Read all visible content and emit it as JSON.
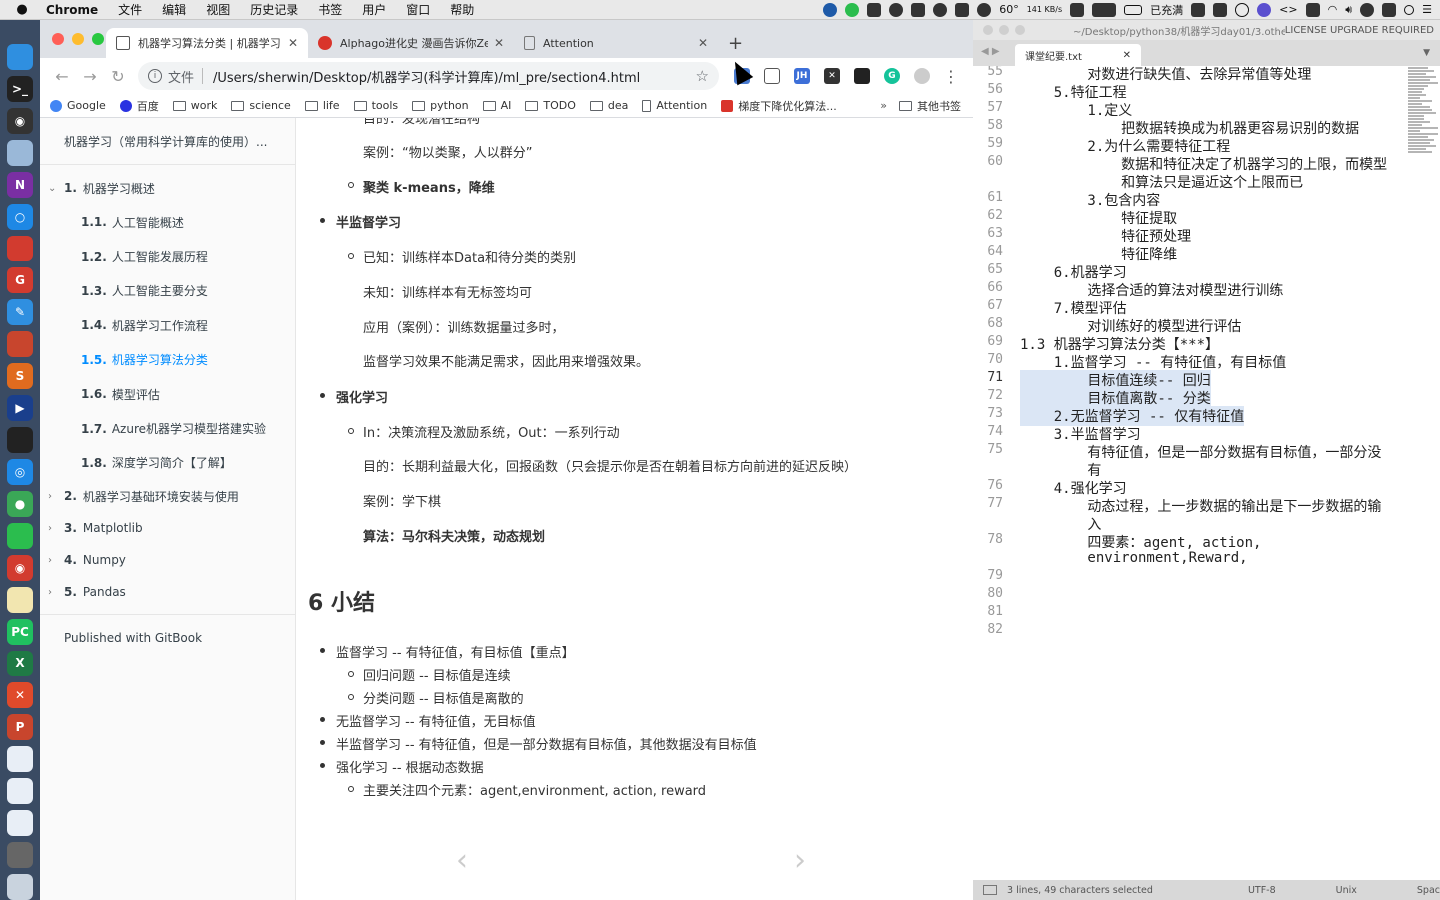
{
  "menubar": {
    "app": "Chrome",
    "items": [
      "文件",
      "编辑",
      "视图",
      "历史记录",
      "书签",
      "用户",
      "窗口",
      "帮助"
    ],
    "tray": {
      "temp": "60°",
      "net": "141 KB/s",
      "battery": "已充满"
    }
  },
  "dock": {
    "icons": [
      {
        "name": "finder-icon",
        "color": "#2f8fe0",
        "glyph": ""
      },
      {
        "name": "terminal-icon",
        "color": "#222222",
        "glyph": ">_"
      },
      {
        "name": "obs-icon",
        "color": "#333333",
        "glyph": "◉"
      },
      {
        "name": "preview-icon",
        "color": "#9ab8d8",
        "glyph": ""
      },
      {
        "name": "onenote-icon",
        "color": "#7a2fa3",
        "glyph": "N"
      },
      {
        "name": "tunnel-icon",
        "color": "#1e88e5",
        "glyph": "○"
      },
      {
        "name": "wps-icon",
        "color": "#d23b2f",
        "glyph": ""
      },
      {
        "name": "grammarly-icon",
        "color": "#d23b2f",
        "glyph": "G"
      },
      {
        "name": "pencil-icon",
        "color": "#2f8fe0",
        "glyph": "✎"
      },
      {
        "name": "powerpoint-icon",
        "color": "#c8452d",
        "glyph": ""
      },
      {
        "name": "sublime-icon",
        "color": "#e06b1f",
        "glyph": "S"
      },
      {
        "name": "quicktime-icon",
        "color": "#1a3f8c",
        "glyph": "▶"
      },
      {
        "name": "activity-monitor-icon",
        "color": "#222222",
        "glyph": ""
      },
      {
        "name": "safari-icon",
        "color": "#1e88e5",
        "glyph": "◎"
      },
      {
        "name": "chrome-icon",
        "color": "#3aa757",
        "glyph": "●"
      },
      {
        "name": "wechat-icon",
        "color": "#2bbd4e",
        "glyph": ""
      },
      {
        "name": "netease-music-icon",
        "color": "#d23b2f",
        "glyph": "◉"
      },
      {
        "name": "notes-icon",
        "color": "#f2e6b0",
        "glyph": ""
      },
      {
        "name": "pycharm-icon",
        "color": "#20c060",
        "glyph": "PC"
      },
      {
        "name": "excel-icon",
        "color": "#1f7a45",
        "glyph": "X"
      },
      {
        "name": "xmind-icon",
        "color": "#e04a2b",
        "glyph": "✕"
      },
      {
        "name": "powerpoint2-icon",
        "color": "#c8452d",
        "glyph": "P"
      },
      {
        "name": "document-icon",
        "color": "#e8eef6",
        "glyph": ""
      },
      {
        "name": "file-icon",
        "color": "#e8eef6",
        "glyph": ""
      },
      {
        "name": "file2-icon",
        "color": "#e8eef6",
        "glyph": ""
      },
      {
        "name": "screenshot-icon",
        "color": "#666666",
        "glyph": ""
      },
      {
        "name": "trash-icon",
        "color": "#c9d3de",
        "glyph": ""
      }
    ]
  },
  "browser": {
    "tabs": [
      {
        "title": "机器学习算法分类 | 机器学习 (",
        "icon_color": "#555555",
        "active": true
      },
      {
        "title": "Alphago进化史 漫画告诉你Zer",
        "icon_color": "#d9342b",
        "active": false
      },
      {
        "title": "Attention",
        "icon_color": "#777777",
        "active": false
      }
    ],
    "scheme_label": "文件",
    "url": "/Users/sherwin/Desktop/机器学习(科学计算库)/ml_pre/section4.html",
    "bookmarks": [
      "Google",
      "百度",
      "work",
      "science",
      "life",
      "tools",
      "python",
      "AI",
      "TODO",
      "dea",
      "Attention",
      "梯度下降优化算法...",
      "»",
      "其他书签"
    ]
  },
  "sidebar": {
    "title": "机器学习（常用科学计算库的使用）...",
    "chapter1": {
      "num": "1.",
      "label": "机器学习概述"
    },
    "subs": [
      {
        "num": "1.1.",
        "label": "人工智能概述"
      },
      {
        "num": "1.2.",
        "label": "人工智能发展历程"
      },
      {
        "num": "1.3.",
        "label": "人工智能主要分支"
      },
      {
        "num": "1.4.",
        "label": "机器学习工作流程"
      },
      {
        "num": "1.5.",
        "label": "机器学习算法分类"
      },
      {
        "num": "1.6.",
        "label": "模型评估"
      },
      {
        "num": "1.7.",
        "label": "Azure机器学习模型搭建实验"
      },
      {
        "num": "1.8.",
        "label": "深度学习简介【了解】"
      }
    ],
    "chapters": [
      {
        "num": "2.",
        "label": "机器学习基础环境安装与使用"
      },
      {
        "num": "3.",
        "label": "Matplotlib"
      },
      {
        "num": "4.",
        "label": "Numpy"
      },
      {
        "num": "5.",
        "label": "Pandas"
      }
    ],
    "published": "Published with GitBook"
  },
  "content": {
    "top_partial": "目的：发现潜在结构",
    "unsup_case": "案例：“物以类聚，人以群分”",
    "unsup_algo": "聚类 k-means，降维",
    "semi_title": "半监督学习",
    "semi_known": "已知：训练样本Data和待分类的类别",
    "semi_unknown": "未知：训练样本有无标签均可",
    "semi_app": "应用（案例）：训练数据量过多时，",
    "semi_note": "监督学习效果不能满足需求，因此用来增强效果。",
    "rl_title": "强化学习",
    "rl_in": "In：决策流程及激励系统，Out：一系列行动",
    "rl_goal": "目的：长期利益最大化，回报函数（只会提示你是否在朝着目标方向前进的延迟反映）",
    "rl_case": "案例：学下棋",
    "rl_algo": "算法：马尔科夫决策，动态规划",
    "summary_title": "6 小结",
    "sum1": "监督学习 -- 有特征值，有目标值【重点】",
    "sum1a": "回归问题 -- 目标值是连续",
    "sum1b": "分类问题 -- 目标值是离散的",
    "sum2": "无监督学习 -- 有特征值，无目标值",
    "sum3": "半监督学习 -- 有特征值，但是一部分数据有目标值，其他数据没有目标值",
    "sum4": "强化学习 -- 根据动态数据",
    "sum4a": "主要关注四个元素：agent,environment, action, reward",
    "prev": "‹",
    "next": "›"
  },
  "editor": {
    "path": "~/Desktop/python38/机器学习day01/3.othe",
    "license": "LICENSE UPGRADE REQUIRED",
    "tab": "课堂纪要.txt",
    "lines": [
      {
        "n": "55",
        "text": "        对数进行缺失值、去除异常值等处理",
        "sel": false
      },
      {
        "n": "56",
        "text": "    5.特征工程",
        "sel": false
      },
      {
        "n": "57",
        "text": "        1.定义",
        "sel": false
      },
      {
        "n": "58",
        "text": "            把数据转换成为机器更容易识别的数据",
        "sel": false
      },
      {
        "n": "59",
        "text": "        2.为什么需要特征工程",
        "sel": false
      },
      {
        "n": "60",
        "text": "            数据和特征决定了机器学习的上限，而模型",
        "sel": false
      },
      {
        "n": "",
        "text": "            和算法只是逼近这个上限而已",
        "sel": false
      },
      {
        "n": "61",
        "text": "        3.包含内容",
        "sel": false
      },
      {
        "n": "62",
        "text": "            特征提取",
        "sel": false
      },
      {
        "n": "63",
        "text": "            特征预处理",
        "sel": false
      },
      {
        "n": "64",
        "text": "            特征降维",
        "sel": false
      },
      {
        "n": "65",
        "text": "    6.机器学习",
        "sel": false
      },
      {
        "n": "66",
        "text": "        选择合适的算法对模型进行训练",
        "sel": false
      },
      {
        "n": "67",
        "text": "    7.模型评估",
        "sel": false
      },
      {
        "n": "68",
        "text": "        对训练好的模型进行评估",
        "sel": false
      },
      {
        "n": "69",
        "text": "1.3 机器学习算法分类【***】",
        "sel": false
      },
      {
        "n": "70",
        "text": "    1.监督学习 -- 有特征值，有目标值",
        "sel": false
      },
      {
        "n": "71",
        "text": "        目标值连续-- 回归",
        "sel": true
      },
      {
        "n": "72",
        "text": "        目标值离散-- 分类",
        "sel": true
      },
      {
        "n": "73",
        "text": "    2.无监督学习 -- 仅有特征值",
        "sel": true
      },
      {
        "n": "74",
        "text": "    3.半监督学习",
        "sel": false
      },
      {
        "n": "75",
        "text": "        有特征值，但是一部分数据有目标值，一部分没",
        "sel": false
      },
      {
        "n": "",
        "text": "        有",
        "sel": false
      },
      {
        "n": "76",
        "text": "    4.强化学习",
        "sel": false
      },
      {
        "n": "77",
        "text": "        动态过程，上一步数据的输出是下一步数据的输",
        "sel": false
      },
      {
        "n": "",
        "text": "        入",
        "sel": false
      },
      {
        "n": "78",
        "text": "        四要素：agent, action,",
        "sel": false
      },
      {
        "n": "",
        "text": "        environment,Reward,",
        "sel": false
      },
      {
        "n": "79",
        "text": "",
        "sel": false
      },
      {
        "n": "80",
        "text": "",
        "sel": false
      },
      {
        "n": "81",
        "text": "",
        "sel": false
      },
      {
        "n": "82",
        "text": "",
        "sel": false
      }
    ],
    "status": {
      "selection": "3 lines, 49 characters selected",
      "encoding": "UTF-8",
      "line_endings": "Unix",
      "indent": "Spac"
    }
  }
}
